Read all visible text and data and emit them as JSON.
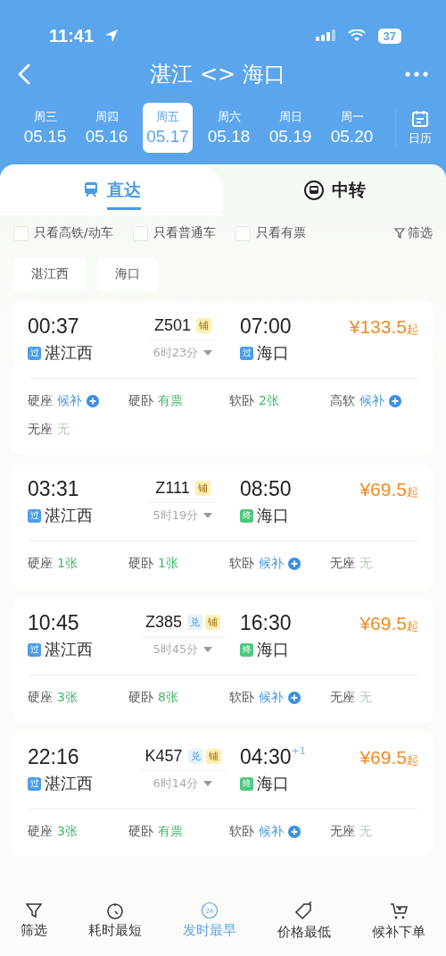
{
  "status_bar": {
    "time": "11:41",
    "battery": "37"
  },
  "nav": {
    "title": "湛江 <> 海口"
  },
  "dates": [
    {
      "weekday": "周三",
      "date": "05.15",
      "selected": false
    },
    {
      "weekday": "周四",
      "date": "05.16",
      "selected": false
    },
    {
      "weekday": "周五",
      "date": "05.17",
      "selected": true
    },
    {
      "weekday": "周六",
      "date": "05.18",
      "selected": false
    },
    {
      "weekday": "周日",
      "date": "05.19",
      "selected": false
    },
    {
      "weekday": "周一",
      "date": "05.20",
      "selected": false
    }
  ],
  "calendar_label": "日历",
  "tabs": [
    {
      "label": "直达",
      "selected": true
    },
    {
      "label": "中转",
      "selected": false
    }
  ],
  "filters": [
    {
      "label": "只看高铁/动车",
      "checked": false
    },
    {
      "label": "只看普通车",
      "checked": false
    },
    {
      "label": "只看有票",
      "checked": false
    }
  ],
  "filter_button": "筛选",
  "stations": [
    "湛江西",
    "海口"
  ],
  "trains": [
    {
      "depart": "00:37",
      "from": "湛江西",
      "from_badge": {
        "text": "过",
        "kind": "pass"
      },
      "number": "Z501",
      "tags": [
        {
          "text": "铺",
          "kind": "berth"
        }
      ],
      "duration": "6时23分",
      "arrive": "07:00",
      "to": "海口",
      "to_badge": {
        "text": "过",
        "kind": "pass"
      },
      "price": "¥133.5",
      "price_suffix": "起",
      "seats": [
        {
          "name": "硬座",
          "status": "候补",
          "kind": "waitlist"
        },
        {
          "name": "硬卧",
          "status": "有票",
          "kind": "available"
        },
        {
          "name": "软卧",
          "status": "2张",
          "kind": "available"
        },
        {
          "name": "高软",
          "status": "候补",
          "kind": "waitlist"
        },
        {
          "name": "无座",
          "status": "无",
          "kind": "none"
        }
      ]
    },
    {
      "depart": "03:31",
      "from": "湛江西",
      "from_badge": {
        "text": "过",
        "kind": "pass"
      },
      "number": "Z111",
      "tags": [
        {
          "text": "铺",
          "kind": "berth"
        }
      ],
      "duration": "5时19分",
      "arrive": "08:50",
      "to": "海口",
      "to_badge": {
        "text": "终",
        "kind": "terminal"
      },
      "price": "¥69.5",
      "price_suffix": "起",
      "seats": [
        {
          "name": "硬座",
          "status": "1张",
          "kind": "available"
        },
        {
          "name": "硬卧",
          "status": "1张",
          "kind": "available"
        },
        {
          "name": "软卧",
          "status": "候补",
          "kind": "waitlist"
        },
        {
          "name": "无座",
          "status": "无",
          "kind": "none"
        }
      ]
    },
    {
      "depart": "10:45",
      "from": "湛江西",
      "from_badge": {
        "text": "过",
        "kind": "pass"
      },
      "number": "Z385",
      "tags": [
        {
          "text": "兑",
          "kind": "redeem"
        },
        {
          "text": "铺",
          "kind": "berth"
        }
      ],
      "duration": "5时45分",
      "arrive": "16:30",
      "to": "海口",
      "to_badge": {
        "text": "终",
        "kind": "terminal"
      },
      "price": "¥69.5",
      "price_suffix": "起",
      "seats": [
        {
          "name": "硬座",
          "status": "3张",
          "kind": "available"
        },
        {
          "name": "硬卧",
          "status": "8张",
          "kind": "available"
        },
        {
          "name": "软卧",
          "status": "候补",
          "kind": "waitlist"
        },
        {
          "name": "无座",
          "status": "无",
          "kind": "none"
        }
      ]
    },
    {
      "depart": "22:16",
      "from": "湛江西",
      "from_badge": {
        "text": "过",
        "kind": "pass"
      },
      "number": "K457",
      "tags": [
        {
          "text": "兑",
          "kind": "redeem"
        },
        {
          "text": "铺",
          "kind": "berth"
        }
      ],
      "duration": "6时14分",
      "arrive": "04:30",
      "next_day": "+1",
      "to": "海口",
      "to_badge": {
        "text": "终",
        "kind": "terminal"
      },
      "price": "¥69.5",
      "price_suffix": "起",
      "seats": [
        {
          "name": "硬座",
          "status": "3张",
          "kind": "available"
        },
        {
          "name": "硬卧",
          "status": "有票",
          "kind": "available"
        },
        {
          "name": "软卧",
          "status": "候补",
          "kind": "waitlist"
        },
        {
          "name": "无座",
          "status": "无",
          "kind": "none"
        }
      ]
    }
  ],
  "bottom_nav": [
    {
      "label": "筛选",
      "selected": false
    },
    {
      "label": "耗时最短",
      "selected": false
    },
    {
      "label": "发时最早",
      "icon_text": "24",
      "selected": true
    },
    {
      "label": "价格最低",
      "selected": false
    },
    {
      "label": "候补下单",
      "selected": false
    }
  ]
}
